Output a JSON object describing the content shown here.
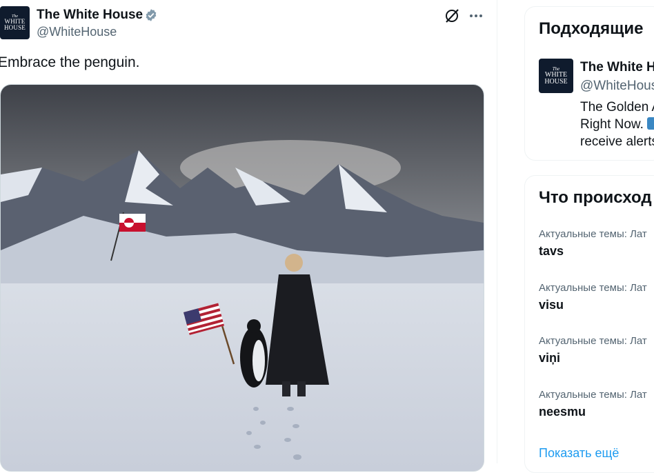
{
  "tweet": {
    "avatar_top": "The",
    "avatar_line1": "WHITE",
    "avatar_line2": "HOUSE",
    "author_name": "The White House",
    "handle": "@WhiteHouse",
    "text": "Embrace the penguin.",
    "icons": [
      "grok-icon",
      "more-icon",
      "verified-badge-icon"
    ]
  },
  "sidebar": {
    "relevant": {
      "title": "Подходящие",
      "name": "The White H",
      "handle": "@WhiteHous",
      "bio_line1": "The Golden A",
      "bio_line2": "Right Now.",
      "bio_line3": "receive alerts"
    },
    "trends": {
      "title": "Что происход",
      "items": [
        {
          "context": "Актуальные темы: Лат",
          "name": "tavs"
        },
        {
          "context": "Актуальные темы: Лат",
          "name": "visu"
        },
        {
          "context": "Актуальные темы: Лат",
          "name": "viņi"
        },
        {
          "context": "Актуальные темы: Лат",
          "name": "neesmu"
        }
      ],
      "show_more": "Показать ещё"
    }
  },
  "colors": {
    "accent": "#1d9bf0",
    "verified": "#829aab",
    "secondary_text": "#536471"
  }
}
